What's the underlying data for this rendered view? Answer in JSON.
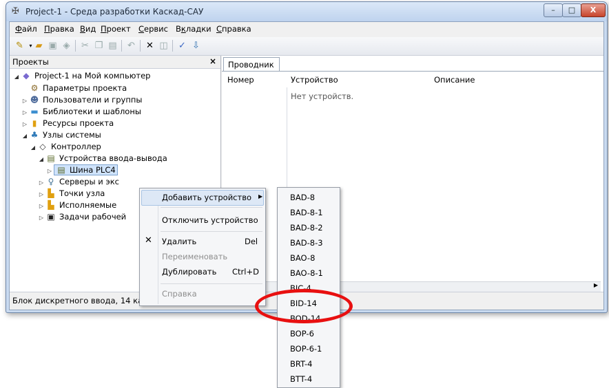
{
  "window": {
    "title": "Project-1 - Среда разработки Каскад-САУ",
    "min": "–",
    "max": "□",
    "close": "X"
  },
  "menu": [
    {
      "u": "Ф",
      "rest": "айл"
    },
    {
      "u": "П",
      "rest": "равка"
    },
    {
      "u": "В",
      "rest": "ид"
    },
    {
      "u": "П",
      "rest": "роект"
    },
    {
      "u": "С",
      "rest": "ервис"
    },
    {
      "u": "",
      "pre": "В",
      "mid": "к",
      "rest": "ладки"
    },
    {
      "u": "С",
      "rest": "правка"
    }
  ],
  "menu_labels": [
    "Файл",
    "Правка",
    "Вид",
    "Проект",
    "Сервис",
    "Вкладки",
    "Справка"
  ],
  "projects_panel": {
    "title": "Проекты",
    "close": "×"
  },
  "tree": [
    {
      "label": "Project-1 на Мой компьютер",
      "icon": "◆"
    },
    {
      "label": "Параметры проекта",
      "icon": "⚙"
    },
    {
      "label": "Пользователи и группы",
      "icon": "☻"
    },
    {
      "label": "Библиотеки и шаблоны",
      "icon": "▬"
    },
    {
      "label": "Ресурсы проекта",
      "icon": "▮"
    },
    {
      "label": "Узлы системы",
      "icon": "♣"
    },
    {
      "label": "Контроллер",
      "icon": "◇"
    },
    {
      "label": "Устройства ввода-вывода",
      "icon": "▤"
    },
    {
      "label": "Шина PLC4",
      "icon": "▤"
    },
    {
      "label": "Серверы и экс",
      "icon": "♀"
    },
    {
      "label": "Точки узла",
      "icon": "▙"
    },
    {
      "label": "Исполняемые",
      "icon": "▙"
    },
    {
      "label": "Задачи рабочей",
      "icon": "▣"
    }
  ],
  "explorer": {
    "tab": "Проводник",
    "columns": [
      "Номер",
      "Устройство",
      "Описание"
    ],
    "empty_text": "Нет устройств."
  },
  "status": "Блок дискретного ввода, 14 кана",
  "context_menu": [
    {
      "label": "Добавить устройство",
      "shortcut": "",
      "arrow": "▶"
    },
    {
      "label": "Отключить устройство",
      "shortcut": ""
    },
    {
      "label": "Удалить",
      "shortcut": "Del",
      "icon": "✕"
    },
    {
      "label": "Переименовать",
      "shortcut": "",
      "disabled": true
    },
    {
      "label": "Дублировать",
      "shortcut": "Ctrl+D"
    },
    {
      "label": "Справка",
      "shortcut": "",
      "disabled": true
    }
  ],
  "submenu": [
    "BAD-8",
    "BAD-8-1",
    "BAD-8-2",
    "BAD-8-3",
    "BAO-8",
    "BAO-8-1",
    "BIC-4",
    "BID-14",
    "BOD-14",
    "BOP-6",
    "BOP-6-1",
    "BRT-4",
    "BTT-4"
  ],
  "highlighted_item": "BID-14",
  "colors": {
    "highlight_ring": "#e81010",
    "selection": "#cfe3fb"
  }
}
